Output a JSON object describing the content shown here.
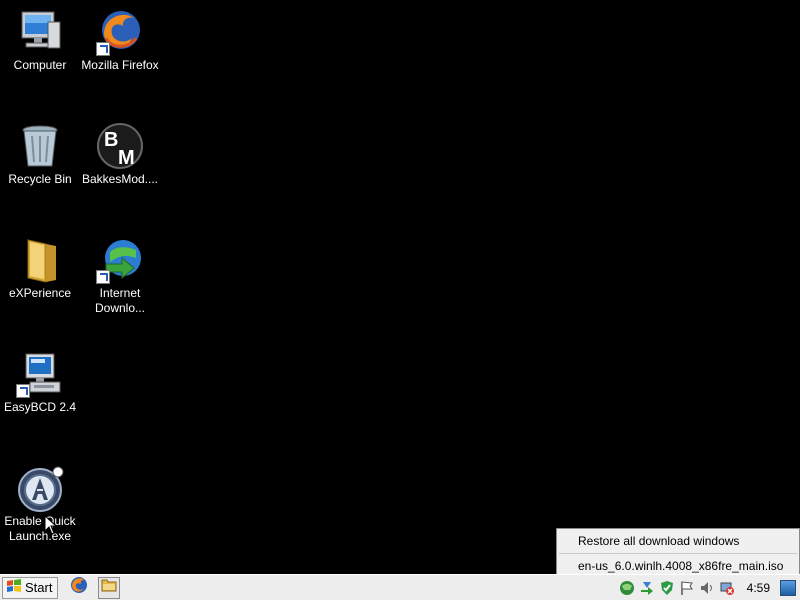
{
  "desktop": {
    "icons": [
      {
        "label": "Computer"
      },
      {
        "label": "Mozilla Firefox"
      },
      {
        "label": "Recycle Bin"
      },
      {
        "label": "BakkesMod...."
      },
      {
        "label": "eXPerience"
      },
      {
        "label": "Internet\nDownlo..."
      },
      {
        "label": "EasyBCD 2.4"
      },
      {
        "label": "Enable Quick\nLaunch.exe"
      }
    ],
    "background_color": "#000000"
  },
  "tray_menu": {
    "items": [
      {
        "label": "Restore all download windows"
      },
      {
        "label": "en-us_6.0.winlh.4008_x86fre_main.iso"
      }
    ]
  },
  "taskbar": {
    "start_label": "Start",
    "quick_launch": [
      "firefox-icon",
      "folder-icon"
    ],
    "tray_icons": [
      "network-icon",
      "download-icon",
      "shield-icon",
      "flag-icon",
      "volume-icon",
      "no-connection-icon"
    ],
    "clock": "4:59"
  }
}
